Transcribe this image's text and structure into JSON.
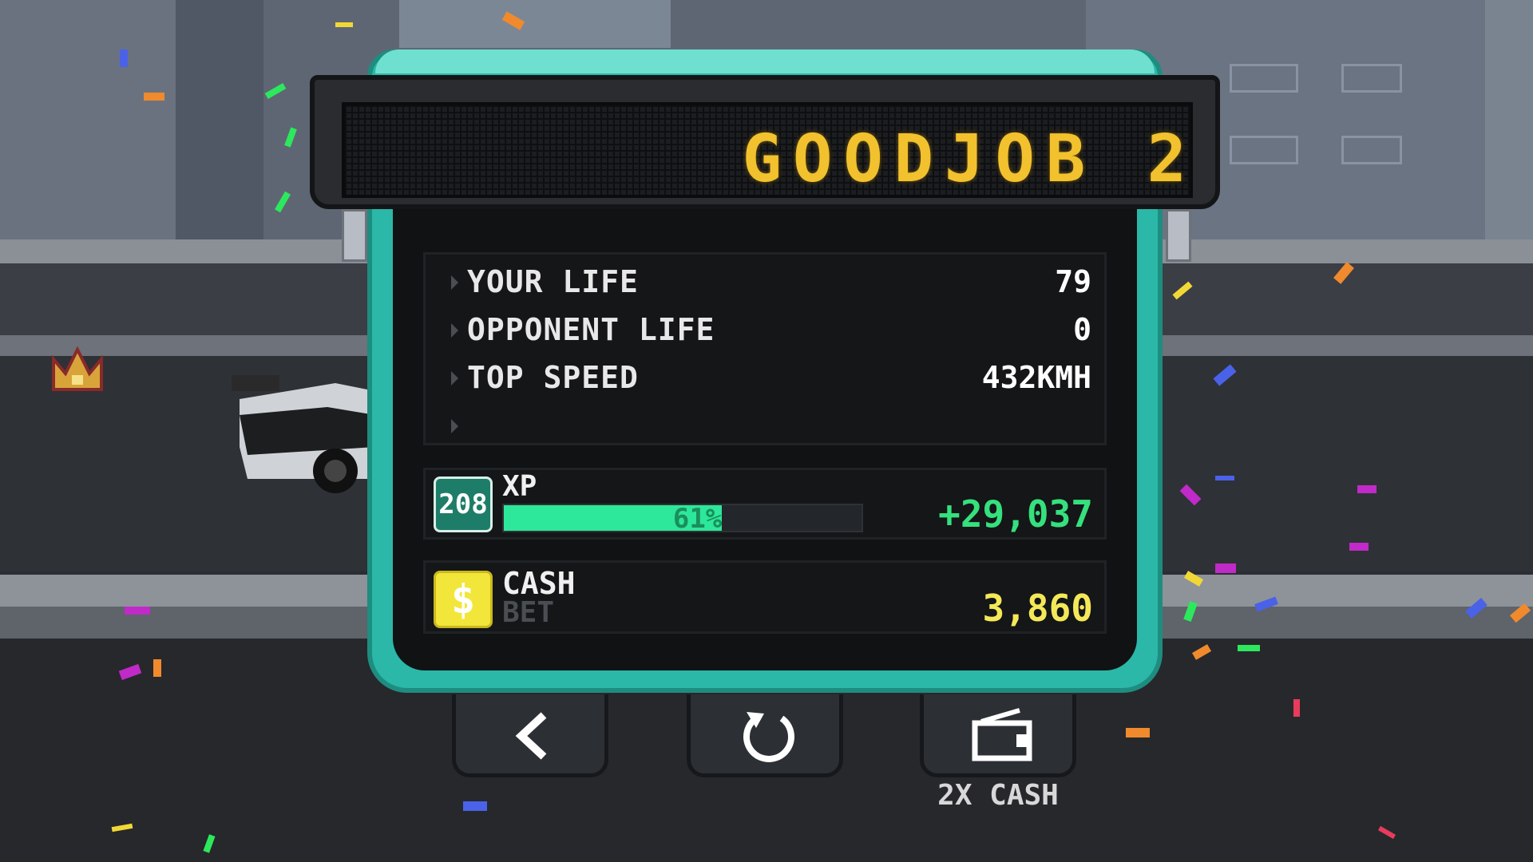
{
  "sign": {
    "text": "GOODJOB 2"
  },
  "stats": [
    {
      "label": "YOUR LIFE",
      "value": "79"
    },
    {
      "label": "OPPONENT LIFE",
      "value": "0"
    },
    {
      "label": "TOP SPEED",
      "value": "432KMH"
    }
  ],
  "xp": {
    "level": "208",
    "label": "XP",
    "progress_percent": 61,
    "progress_text": "61%",
    "gain": "+29,037"
  },
  "cash": {
    "label": "CASH",
    "bet_label": "BET",
    "value": "3,860",
    "icon": "dollar-icon"
  },
  "buttons": {
    "back_icon": "back-arrow-icon",
    "restart_icon": "restart-icon",
    "double_cash_icon": "ad-tv-icon",
    "double_cash_label": "2X CASH"
  },
  "colors": {
    "panel_teal": "#2bb8a8",
    "sign_led": "#f2c12e",
    "xp_green": "#2de89a",
    "cash_yellow": "#f5e858"
  }
}
